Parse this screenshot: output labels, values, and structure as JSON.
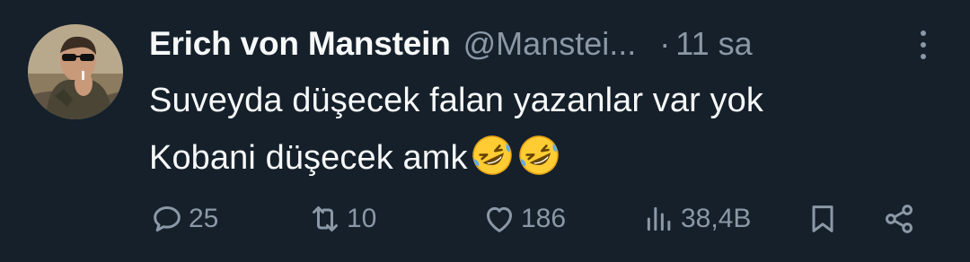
{
  "tweet": {
    "author": {
      "display_name": "Erich von Manstein",
      "handle": "@Manstei...",
      "avatar_icon": "avatar-photo"
    },
    "separator": "·",
    "time": "11 sa",
    "more_icon": "more-vertical-icon",
    "text_lines": [
      "Suveyda düşecek falan yazanlar var yok",
      "Kobani düşecek amk"
    ],
    "emojis": [
      "rolling-on-the-floor-laughing",
      "rolling-on-the-floor-laughing"
    ],
    "actions": {
      "replies": "25",
      "retweets": "10",
      "likes": "186",
      "views": "38,4B"
    }
  },
  "colors": {
    "background": "#15202b",
    "primary_text": "#f7f9f9",
    "secondary_text": "#8b98a5"
  }
}
